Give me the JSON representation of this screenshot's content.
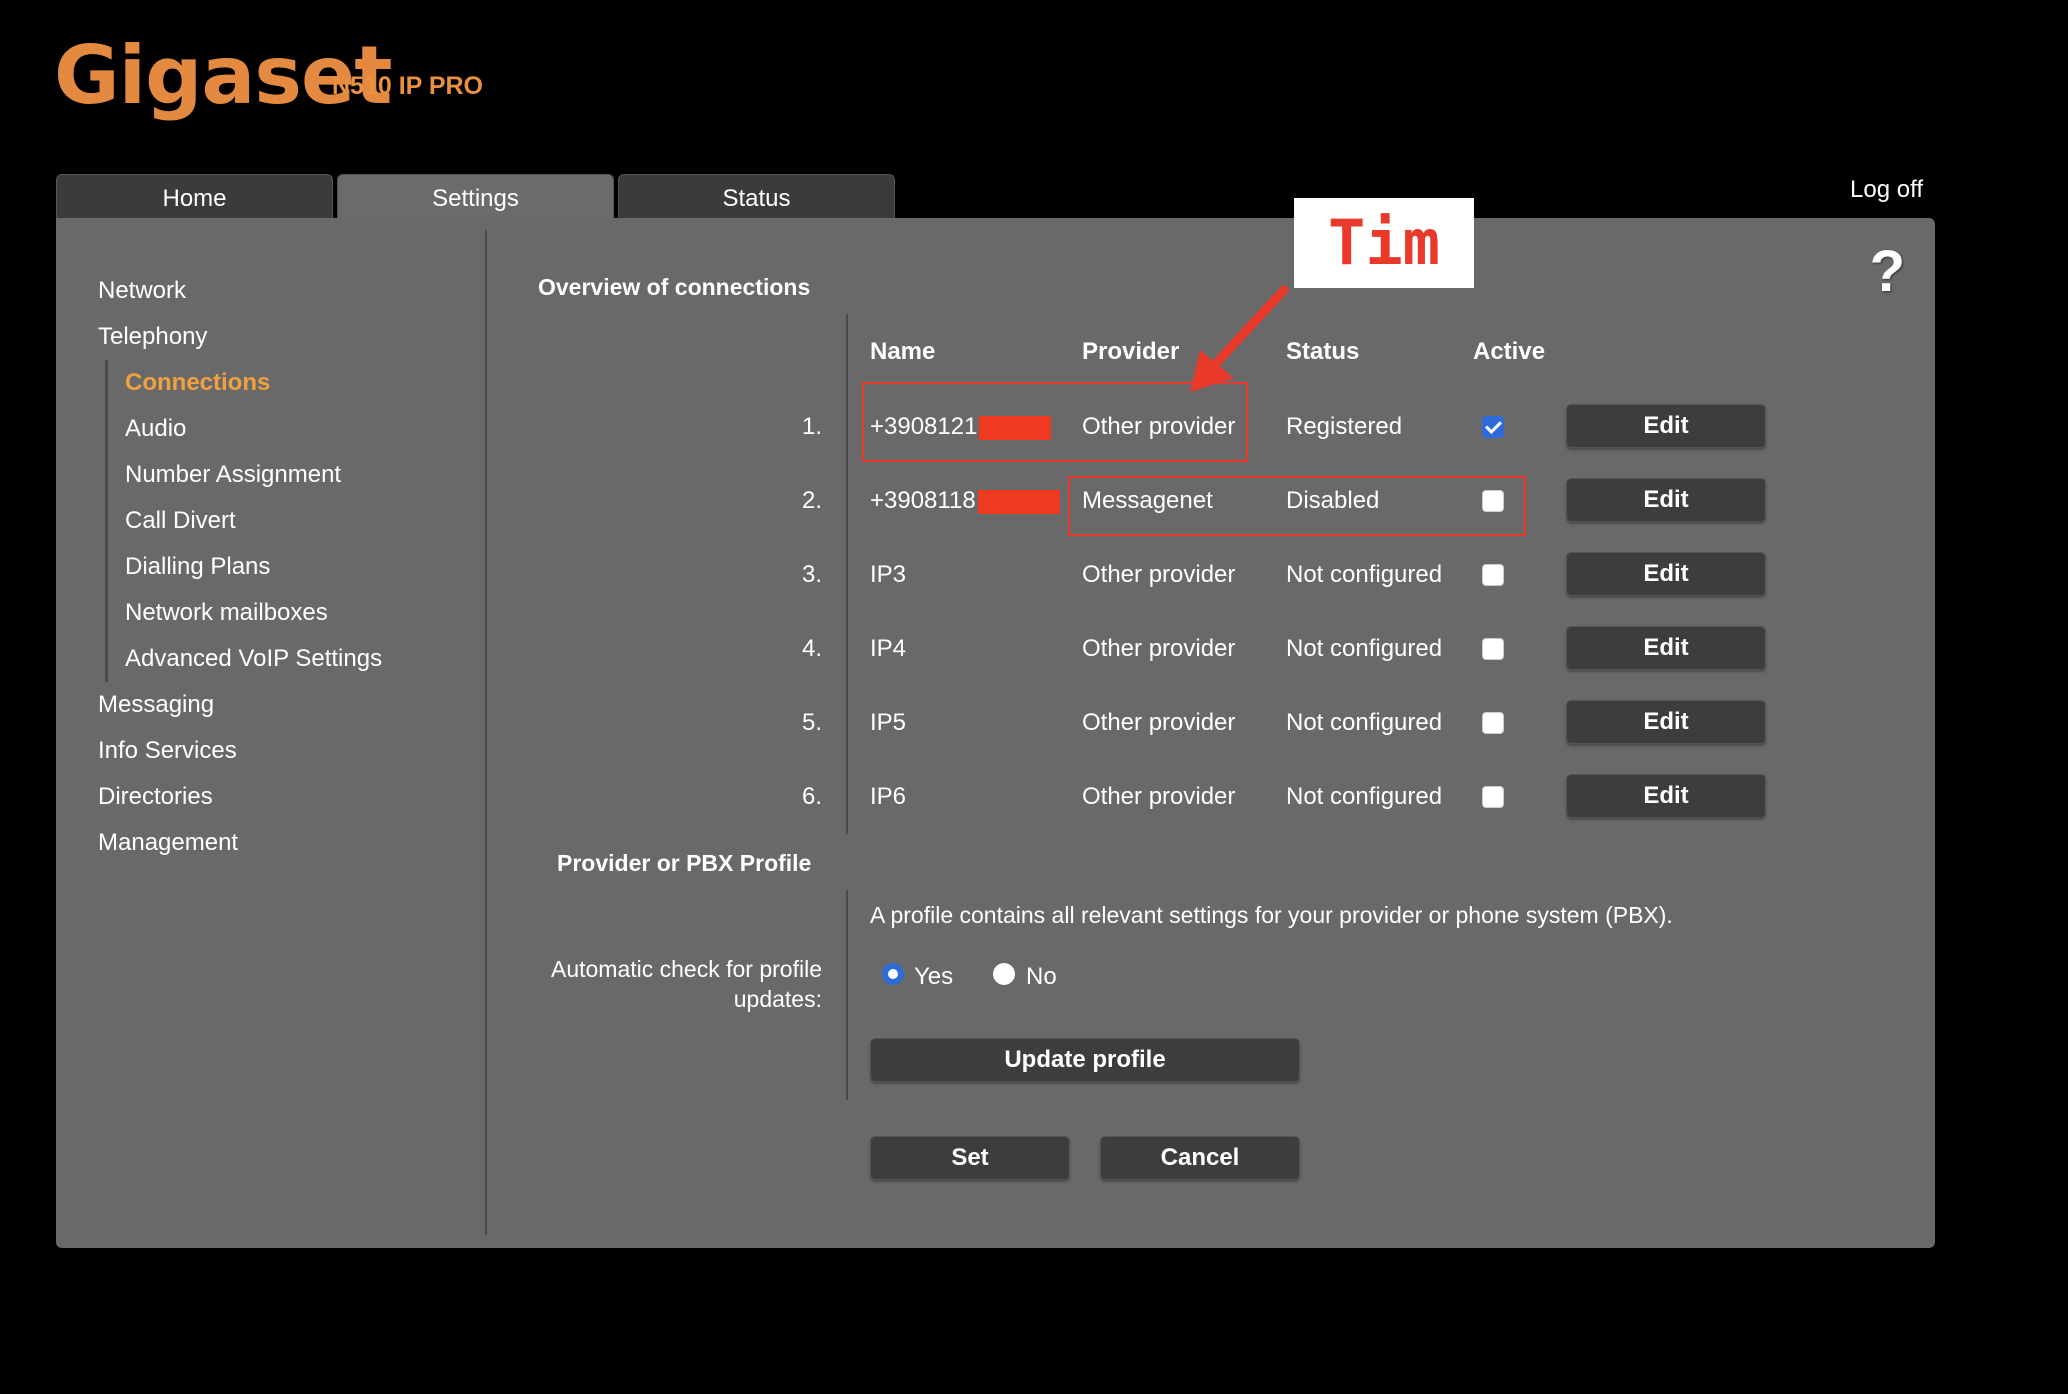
{
  "brand": {
    "logo": "Gigaset",
    "model": "N510 IP PRO"
  },
  "tabs": [
    {
      "label": "Home"
    },
    {
      "label": "Settings"
    },
    {
      "label": "Status"
    }
  ],
  "logoff": "Log off",
  "help": "?",
  "sidebar": {
    "items_top": [
      {
        "label": "Network"
      },
      {
        "label": "Telephony"
      }
    ],
    "sub": [
      {
        "label": "Connections"
      },
      {
        "label": "Audio"
      },
      {
        "label": "Number Assignment"
      },
      {
        "label": "Call Divert"
      },
      {
        "label": "Dialling Plans"
      },
      {
        "label": "Network mailboxes"
      },
      {
        "label": "Advanced VoIP Settings"
      }
    ],
    "items_bottom": [
      {
        "label": "Messaging"
      },
      {
        "label": "Info Services"
      },
      {
        "label": "Directories"
      },
      {
        "label": "Management"
      }
    ]
  },
  "connections": {
    "title": "Overview of connections",
    "headers": {
      "name": "Name",
      "provider": "Provider",
      "status": "Status",
      "active": "Active"
    },
    "rows": [
      {
        "num": "1.",
        "name": "+3908121",
        "provider": "Other provider",
        "status": "Registered",
        "active": true,
        "edit": "Edit"
      },
      {
        "num": "2.",
        "name": "+3908118",
        "provider": "Messagenet",
        "status": "Disabled",
        "active": false,
        "edit": "Edit"
      },
      {
        "num": "3.",
        "name": "IP3",
        "provider": "Other provider",
        "status": "Not configured",
        "active": false,
        "edit": "Edit"
      },
      {
        "num": "4.",
        "name": "IP4",
        "provider": "Other provider",
        "status": "Not configured",
        "active": false,
        "edit": "Edit"
      },
      {
        "num": "5.",
        "name": "IP5",
        "provider": "Other provider",
        "status": "Not configured",
        "active": false,
        "edit": "Edit"
      },
      {
        "num": "6.",
        "name": "IP6",
        "provider": "Other provider",
        "status": "Not configured",
        "active": false,
        "edit": "Edit"
      }
    ]
  },
  "profile": {
    "title": "Provider or PBX Profile",
    "description": "A profile contains all relevant settings for your provider or phone system (PBX).",
    "auto_check_label_1": "Automatic check for profile",
    "auto_check_label_2": "updates:",
    "yes": "Yes",
    "no": "No",
    "selected": "Yes",
    "update_button": "Update profile"
  },
  "actions": {
    "set": "Set",
    "cancel": "Cancel"
  },
  "annotation": {
    "label": "Tim",
    "color": "#e8392a"
  }
}
